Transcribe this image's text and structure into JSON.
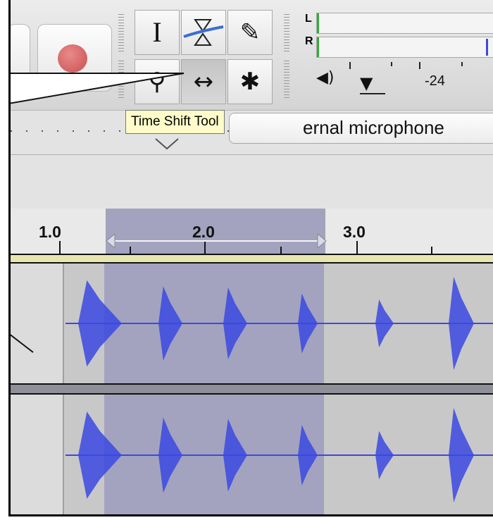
{
  "toolbar": {
    "tools": [
      {
        "id": "selection",
        "glyph": "I"
      },
      {
        "id": "envelope",
        "glyph": "⧖"
      },
      {
        "id": "draw",
        "glyph": "✎"
      },
      {
        "id": "zoom",
        "glyph": "⚲"
      },
      {
        "id": "time-shift",
        "glyph": "↔"
      },
      {
        "id": "multi",
        "glyph": "✱"
      }
    ],
    "meter": {
      "left_label": "L",
      "right_label": "R",
      "scale_value": "-24"
    },
    "speaker_glyph": "◀)",
    "dropdown_glyph": "▼"
  },
  "tooltip": {
    "text": "Time Shift Tool"
  },
  "device": {
    "visible_text": "ernal microphone"
  },
  "timeline": {
    "labels": [
      "1.0",
      "2.0",
      "3.0"
    ]
  },
  "colors": {
    "waveform": "#3b49e0",
    "selection": "#a3a3bf",
    "tooltip_bg": "#fffcc9"
  }
}
